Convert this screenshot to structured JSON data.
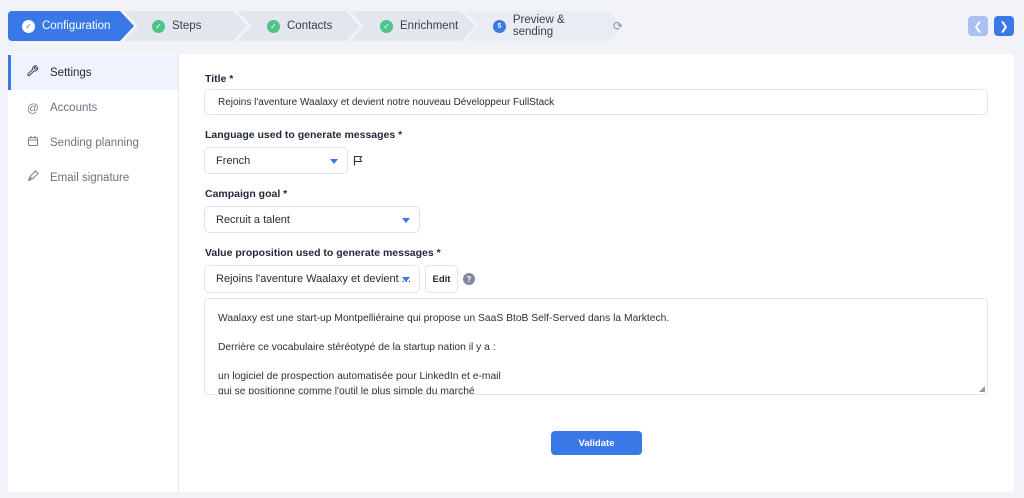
{
  "stepper": {
    "steps": [
      {
        "label": "Configuration",
        "state": "active"
      },
      {
        "label": "Steps",
        "state": "done"
      },
      {
        "label": "Contacts",
        "state": "done"
      },
      {
        "label": "Enrichment",
        "state": "done"
      },
      {
        "label": "Preview & sending",
        "state": "pending",
        "number": "5"
      }
    ],
    "nav": {
      "prev_icon": "chevron-left-icon",
      "next_icon": "chevron-right-icon"
    }
  },
  "sidebar": {
    "items": [
      {
        "label": "Settings",
        "icon": "wrench-icon",
        "active": true
      },
      {
        "label": "Accounts",
        "icon": "at-icon",
        "active": false
      },
      {
        "label": "Sending planning",
        "icon": "calendar-icon",
        "active": false
      },
      {
        "label": "Email signature",
        "icon": "pen-nib-icon",
        "active": false
      }
    ]
  },
  "form": {
    "title_label": "Title *",
    "title_value": "Rejoins l'aventure Waalaxy et devient notre nouveau Développeur FullStack",
    "language_label": "Language used to generate messages *",
    "language_value": "French",
    "goal_label": "Campaign goal *",
    "goal_value": "Recruit a talent",
    "value_prop_label": "Value proposition used to generate messages *",
    "value_prop_value": "Rejoins l'aventure Waalaxy et devient ...",
    "edit_label": "Edit",
    "help_text": "?",
    "message_lines": [
      "Waalaxy est une start-up Montpelliéraine qui propose un SaaS BtoB Self-Served dans la Marktech.",
      "Derrière ce vocabulaire stéréotypé de la startup nation il y a :",
      "un logiciel de prospection automatisée pour LinkedIn et e-mail",
      "qui se positionne comme l'outil le plus simple du marché"
    ],
    "validate_label": "Validate"
  },
  "colors": {
    "accent": "#3b78e7",
    "done": "#4cc48a"
  }
}
